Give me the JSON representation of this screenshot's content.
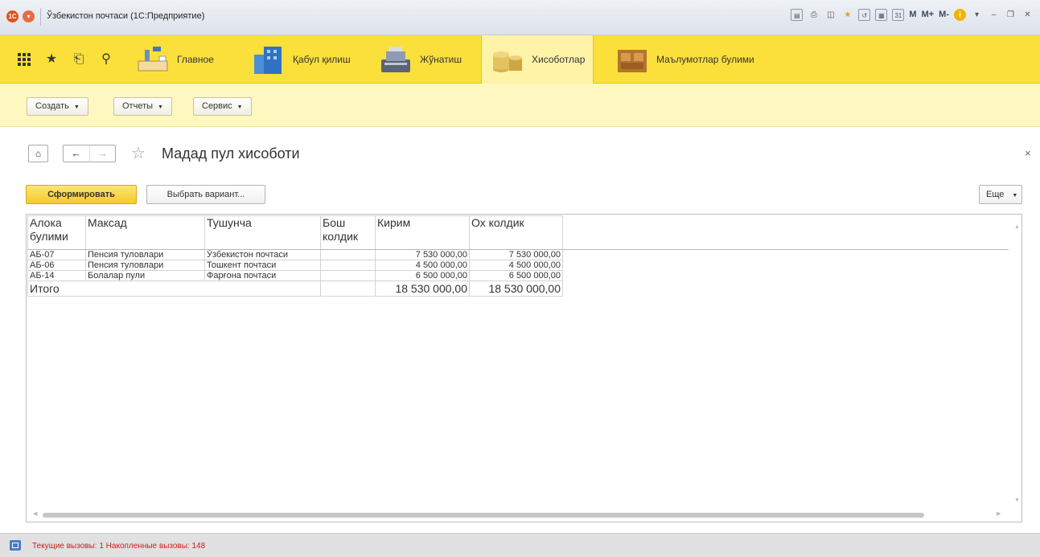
{
  "window": {
    "logo": "1С",
    "title": "Ўзбекистон почтаси  (1С:Предприятие)",
    "tools": [
      "save-icon",
      "print-icon",
      "preview-icon",
      "favorite-icon",
      "history-icon",
      "calculator-icon",
      "calendar-icon"
    ],
    "memory_buttons": [
      "M",
      "M+",
      "M-"
    ]
  },
  "sections": {
    "items": [
      {
        "label": "Главное",
        "icon": "desk-lamp-icon"
      },
      {
        "label": "Қабул қилиш",
        "icon": "building-icon"
      },
      {
        "label": "Жўнатиш",
        "icon": "cash-register-icon"
      },
      {
        "label": "Хисоботлар",
        "icon": "coins-icon",
        "active": true
      },
      {
        "label": "Маълумотлар булими",
        "icon": "furniture-icon"
      }
    ]
  },
  "toolbar": {
    "create_label": "Создать",
    "reports_label": "Отчеты",
    "service_label": "Сервис"
  },
  "page": {
    "title": "Мадад пул хисоботи",
    "generate_label": "Сформировать",
    "variant_label": "Выбрать вариант...",
    "more_label": "Еще"
  },
  "report": {
    "columns": [
      "Алока булими",
      "Максад",
      "Тушунча",
      "Бош колдик",
      "Кирим",
      "Ох колдик"
    ],
    "rows": [
      {
        "code": "АБ-07",
        "purpose": "Пенсия туловлари",
        "notion": "Ўзбекистон почтаси",
        "start": "",
        "income": "7 530 000,00",
        "end": "7 530 000,00"
      },
      {
        "code": "АБ-06",
        "purpose": "Пенсия туловлари",
        "notion": "Тошкент почтаси",
        "start": "",
        "income": "4 500 000,00",
        "end": "4 500 000,00"
      },
      {
        "code": "АБ-14",
        "purpose": "Болалар пули",
        "notion": "Фарғона почтаси",
        "start": "",
        "income": "6 500 000,00",
        "end": "6 500 000,00"
      }
    ],
    "total": {
      "label": "Итого",
      "income": "18 530 000,00",
      "end": "18 530 000,00"
    }
  },
  "status": {
    "text": "Текущие вызовы: 1   Накопленные вызовы: 148",
    "color": "#cc1f1f"
  },
  "colors": {
    "section_bar": "#fbe03c",
    "function_bar": "#fff7c0",
    "primary_button": "#f5c930"
  }
}
